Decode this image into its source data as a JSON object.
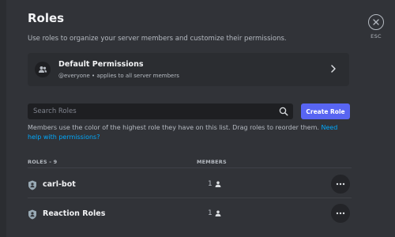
{
  "page": {
    "title": "Roles",
    "subtitle": "Use roles to organize your server members and customize their permissions."
  },
  "close": {
    "esc_label": "ESC"
  },
  "default_permissions": {
    "title": "Default Permissions",
    "description": "@everyone • applies to all server members"
  },
  "search": {
    "placeholder": "Search Roles",
    "value": ""
  },
  "create_role_label": "Create Role",
  "help": {
    "text": "Members use the color of the highest role they have on this list. Drag roles to reorder them.",
    "link": "Need help with permissions?"
  },
  "table": {
    "roles_header": "ROLES - 9",
    "members_header": "MEMBERS"
  },
  "roles": [
    {
      "name": "carl-bot",
      "members": "1"
    },
    {
      "name": "Reaction Roles",
      "members": "1"
    }
  ],
  "icons": {
    "close": "close-icon",
    "users": "users-icon",
    "chevron": "chevron-right-icon",
    "search": "search-icon",
    "shield": "role-shield-icon",
    "member": "person-icon",
    "more": "more-dots-icon"
  },
  "colors": {
    "background": "#313338",
    "card": "#2b2d31",
    "input": "#1e1f22",
    "accent": "#5865f2",
    "link": "#00a8fc",
    "text_primary": "#f2f3f5",
    "text_secondary": "#b5bac1"
  }
}
